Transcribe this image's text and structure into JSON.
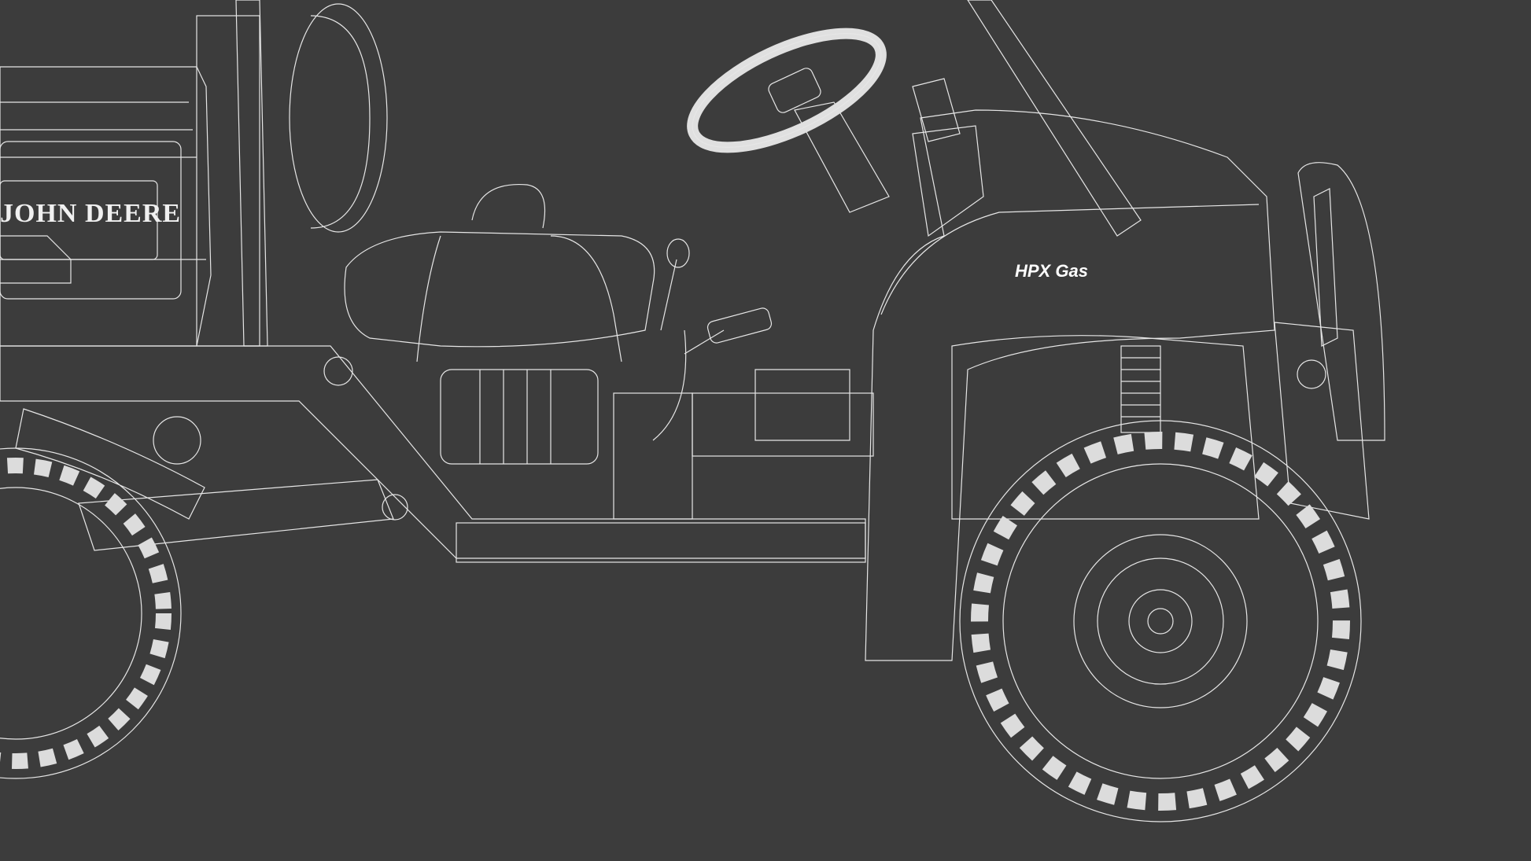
{
  "scene": {
    "background_color": "#3c3c3c",
    "wire_color": "#e6e6e6",
    "surface_color": "#4a4a4a"
  },
  "labels": {
    "brand": "JOHN DEERE",
    "model_badge": "HPX Gas"
  }
}
